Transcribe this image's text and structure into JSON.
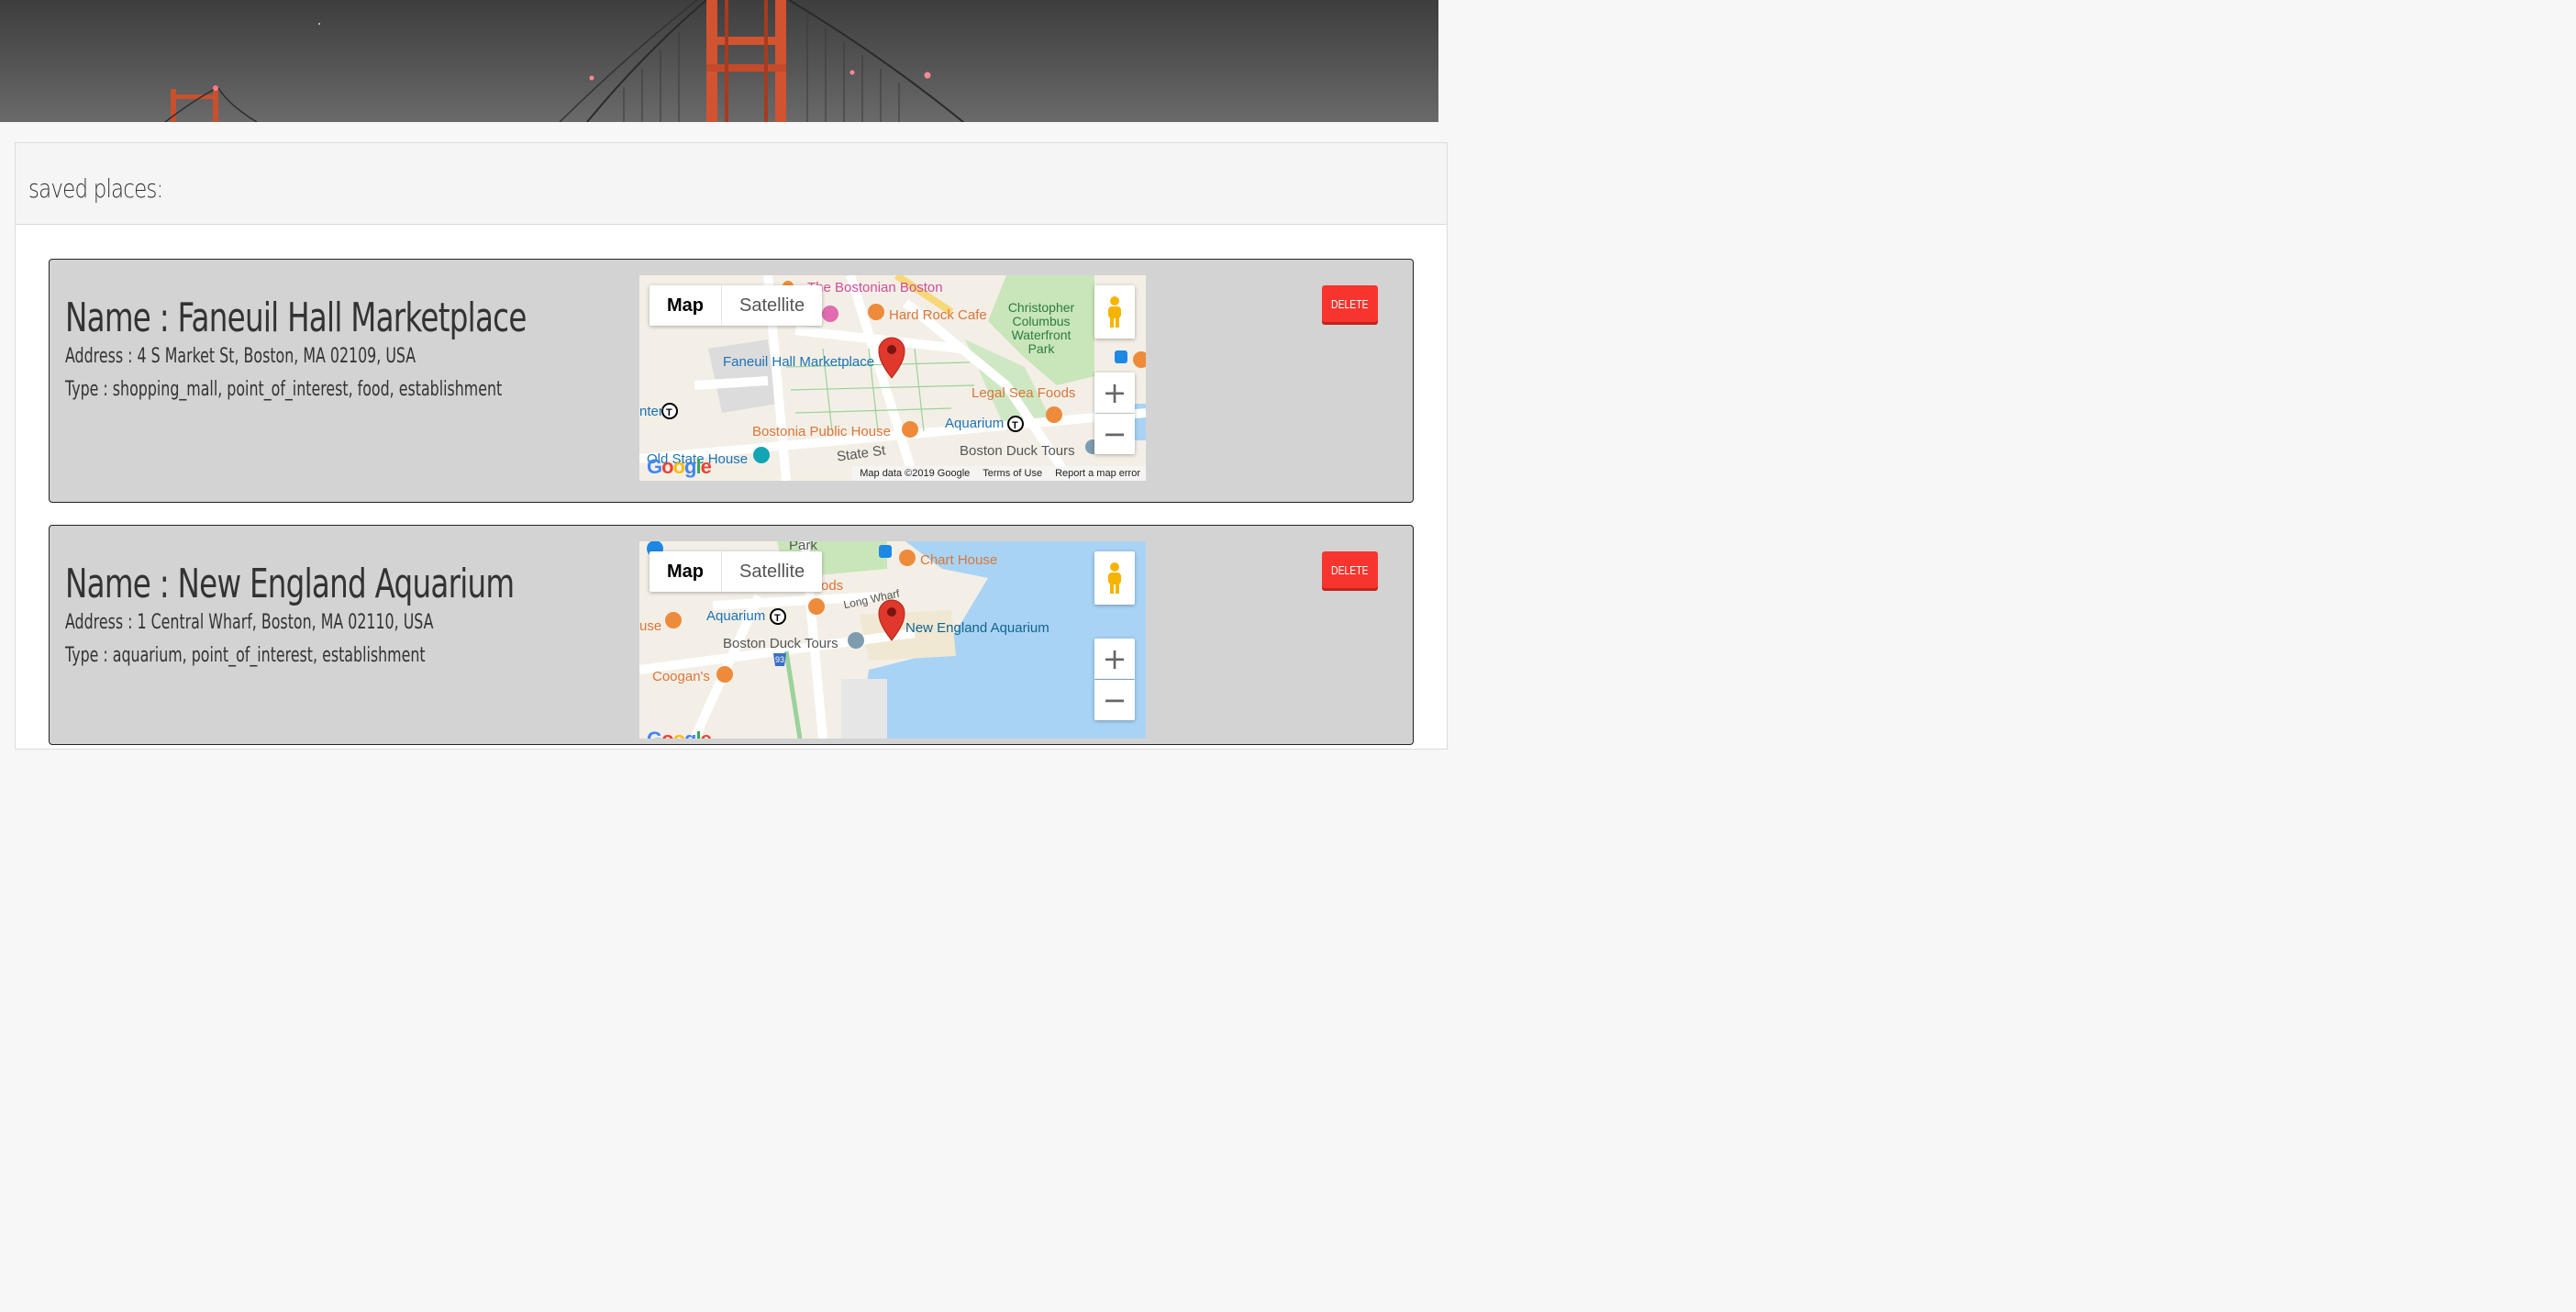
{
  "panel": {
    "title": "saved places:"
  },
  "places": [
    {
      "name": "Name : Faneuil Hall Marketplace",
      "address": "Address : 4 S Market St, Boston, MA 02109, USA",
      "type": "Type : shopping_mall, point_of_interest, food, establishment",
      "delete_label": "DELETE",
      "map": {
        "type_options": [
          "Map",
          "Satellite"
        ],
        "selected_type": "Map",
        "attribution": [
          "Map data ©2019 Google",
          "Terms of Use",
          "Report a map error"
        ],
        "logo": "Google",
        "labels": {
          "bostonian": "The Bostonian Boston",
          "hard_rock": "Hard Rock Cafe",
          "columbus": "Christopher Columbus Waterfront Park",
          "faneuil": "Faneuil Hall Marketplace",
          "legal": "Legal Sea Foods",
          "center": "nter",
          "bostonia": "Bostonia Public House",
          "aquarium": "Aquarium",
          "state_st": "State St",
          "old_state": "Old State House",
          "duck": "Boston Duck Tours"
        }
      }
    },
    {
      "name": "Name : New England Aquarium",
      "address": "Address : 1 Central Wharf, Boston, MA 02110, USA",
      "type": "Type : aquarium, point_of_interest, establishment",
      "delete_label": "DELETE",
      "map": {
        "type_options": [
          "Map",
          "Satellite"
        ],
        "selected_type": "Map",
        "logo": "Google",
        "labels": {
          "park": "Park",
          "chart_house": "Chart House",
          "ods": "ods",
          "long_wharf": "Long Wharf",
          "aquarium": "Aquarium",
          "use": "use",
          "nea": "New England Aquarium",
          "duck": "Boston Duck Tours",
          "coogans": "Coogan's",
          "route": "93"
        }
      }
    }
  ],
  "colors": {
    "delete": "#f7352e",
    "card": "#d3d3d3",
    "map_water": "#a9d3f5",
    "map_park": "#c8e6b9",
    "marker": "#e0382c"
  },
  "icons": [
    "pegman-icon",
    "zoom-in-icon",
    "zoom-out-icon",
    "map-marker-icon",
    "restaurant-icon",
    "museum-icon",
    "subway-icon"
  ]
}
